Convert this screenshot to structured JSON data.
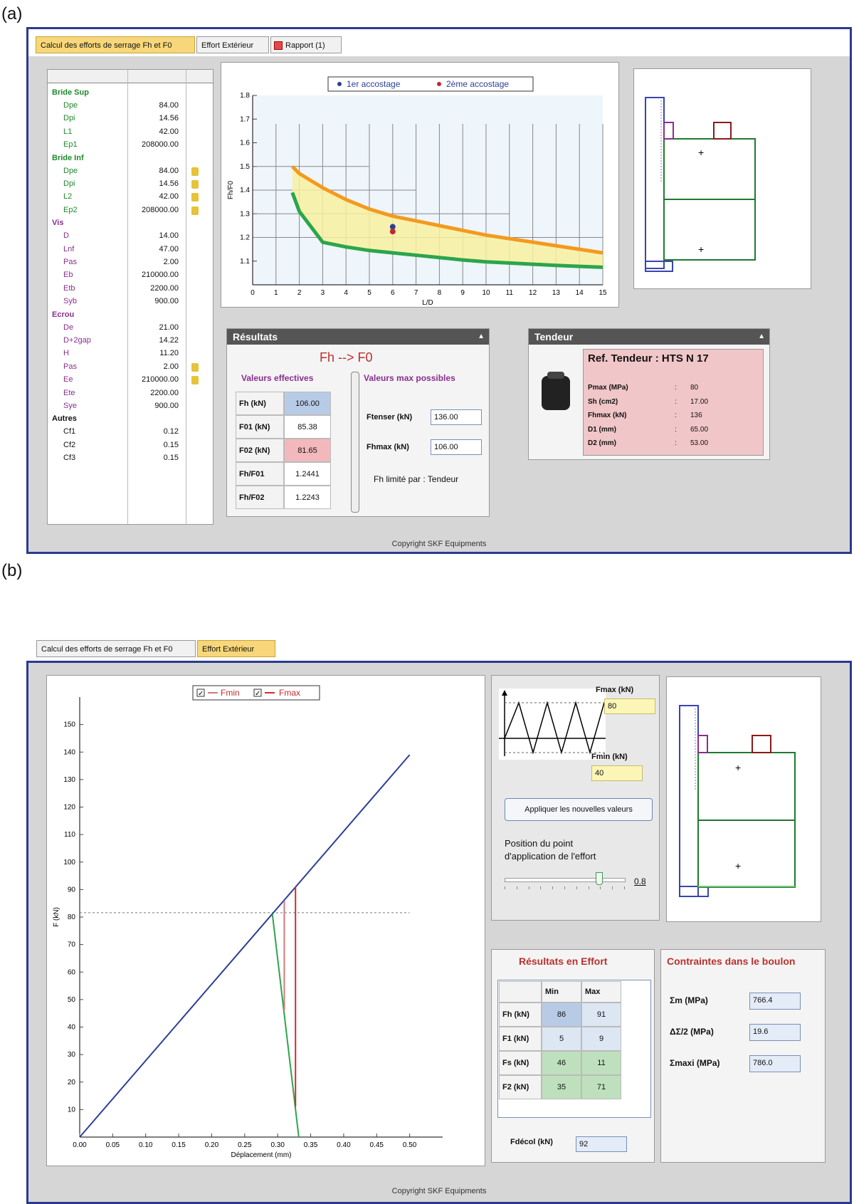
{
  "labels": {
    "a": "(a)",
    "b": "(b)"
  },
  "window_a": {
    "tabs": [
      {
        "label": "Calcul des efforts de serrage Fh et F0",
        "active": true
      },
      {
        "label": "Effort Extérieur",
        "active": false
      },
      {
        "label": "Rapport (1)",
        "active": false
      }
    ],
    "copyright": "Copyright SKF Equipments",
    "tree": [
      {
        "group": "Bride Sup",
        "color": "g",
        "items": [
          {
            "name": "Dpe",
            "value": "84.00"
          },
          {
            "name": "Dpi",
            "value": "14.56"
          },
          {
            "name": "L1",
            "value": "42.00"
          },
          {
            "name": "Ep1",
            "value": "208000.00"
          }
        ]
      },
      {
        "group": "Bride Inf",
        "color": "g",
        "items": [
          {
            "name": "Dpe",
            "value": "84.00",
            "lock": true
          },
          {
            "name": "Dpi",
            "value": "14.56",
            "lock": true
          },
          {
            "name": "L2",
            "value": "42.00",
            "lock": true
          },
          {
            "name": "Ep2",
            "value": "208000.00",
            "lock": true
          }
        ]
      },
      {
        "group": "Vis",
        "color": "m",
        "items": [
          {
            "name": "D",
            "value": "14.00"
          },
          {
            "name": "Lnf",
            "value": "47.00"
          },
          {
            "name": "Pas",
            "value": "2.00"
          },
          {
            "name": "Eb",
            "value": "210000.00"
          },
          {
            "name": "Etb",
            "value": "2200.00"
          },
          {
            "name": "Syb",
            "value": "900.00"
          }
        ]
      },
      {
        "group": "Ecrou",
        "color": "m",
        "items": [
          {
            "name": "De",
            "value": "21.00"
          },
          {
            "name": "D+2gap",
            "value": "14.22"
          },
          {
            "name": "H",
            "value": "11.20"
          },
          {
            "name": "Pas",
            "value": "2.00",
            "lock": true
          },
          {
            "name": "Ee",
            "value": "210000.00",
            "lock": true
          },
          {
            "name": "Ete",
            "value": "2200.00"
          },
          {
            "name": "Sye",
            "value": "900.00"
          }
        ]
      },
      {
        "group": "Autres",
        "color": "k",
        "items": [
          {
            "name": "Cf1",
            "value": "0.12"
          },
          {
            "name": "Cf2",
            "value": "0.15"
          },
          {
            "name": "Cf3",
            "value": "0.15"
          }
        ]
      }
    ],
    "chart_legend": [
      "1er accostage",
      "2ème accostage"
    ],
    "resultats": {
      "header": "Résultats",
      "title": "Fh --> F0",
      "eff_title": "Valeurs effectives",
      "max_title": "Valeurs max possibles",
      "rows": [
        {
          "label": "Fh (kN)",
          "value": "106.00",
          "bg": "#b8cbe6"
        },
        {
          "label": "F01 (kN)",
          "value": "85.38",
          "bg": "#ffffff"
        },
        {
          "label": "F02 (kN)",
          "value": "81.65",
          "bg": "#f3b8bb"
        },
        {
          "label": "Fh/F01",
          "value": "1.2441",
          "bg": "#ffffff"
        },
        {
          "label": "Fh/F02",
          "value": "1.2243",
          "bg": "#ffffff"
        }
      ],
      "ftenser_label": "Ftenser (kN)",
      "ftenser_value": "136.00",
      "fhmax_label": "Fhmax (kN)",
      "fhmax_value": "106.00",
      "limit_text": "Fh limité par : Tendeur"
    },
    "tendeur": {
      "header": "Tendeur",
      "ref": "Ref. Tendeur : HTS N 17",
      "rows": [
        {
          "label": "Pmax (MPa)",
          "value": "80"
        },
        {
          "label": "Sh (cm2)",
          "value": "17.00"
        },
        {
          "label": "Fhmax (kN)",
          "value": "136"
        },
        {
          "label": "D1 (mm)",
          "value": "65.00"
        },
        {
          "label": "D2 (mm)",
          "value": "53.00"
        }
      ]
    }
  },
  "window_b": {
    "tabs": [
      {
        "label": "Calcul des efforts de serrage Fh et F0",
        "active": false
      },
      {
        "label": "Effort Extérieur",
        "active": true
      }
    ],
    "copyright": "Copyright SKF Equipments",
    "chart_legend": [
      "Fmin",
      "Fmax"
    ],
    "fmax_label": "Fmax (kN)",
    "fmax_value": "80",
    "fmin_label": "Fmin (kN)",
    "fmin_value": "40",
    "apply_label": "Appliquer les nouvelles valeurs",
    "position_label_1": "Position du point",
    "position_label_2": "d'application de l'effort",
    "position_value": "0.8",
    "position_fraction": 0.8,
    "res_effort": {
      "title": "Résultats en Effort",
      "headers": [
        "Min",
        "Max"
      ],
      "rows": [
        {
          "label": "Fh (kN)",
          "min": "86",
          "max": "91",
          "bg": [
            "#b8cbe6",
            "#dde6f3"
          ]
        },
        {
          "label": "F1 (kN)",
          "min": "5",
          "max": "9",
          "bg": [
            "#dde6f3",
            "#dde6f3"
          ]
        },
        {
          "label": "Fs (kN)",
          "min": "46",
          "max": "11",
          "bg": [
            "#bfe0bd",
            "#bfe0bd"
          ]
        },
        {
          "label": "F2 (kN)",
          "min": "35",
          "max": "71",
          "bg": [
            "#bfe0bd",
            "#bfe0bd"
          ]
        }
      ],
      "fdecol_label": "Fdécol (kN)",
      "fdecol_value": "92"
    },
    "contraintes": {
      "title": "Contraintes dans le boulon",
      "rows": [
        {
          "label": "Σm (MPa)",
          "value": "766.4"
        },
        {
          "label": "ΔΣ/2 (MPa)",
          "value": "19.6"
        },
        {
          "label": "Σmaxi (MPa)",
          "value": "786.0"
        }
      ]
    }
  },
  "chart_data": [
    {
      "type": "line",
      "xlabel": "L/D",
      "ylabel": "Fh/F0",
      "xlim": [
        0,
        15
      ],
      "ylim": [
        1.0,
        1.8
      ],
      "xticks": [
        0,
        1,
        2,
        3,
        4,
        5,
        6,
        7,
        8,
        9,
        10,
        11,
        12,
        13,
        14,
        15
      ],
      "yticks": [
        1.1,
        1.2,
        1.3,
        1.4,
        1.5,
        1.6,
        1.7,
        1.8
      ],
      "series": [
        {
          "name": "",
          "color": "#f39a1e",
          "x": [
            1.7,
            2,
            3,
            4,
            5,
            6,
            7,
            8,
            9,
            10,
            11,
            12,
            13,
            14,
            15
          ],
          "y": [
            1.5,
            1.47,
            1.41,
            1.36,
            1.32,
            1.29,
            1.27,
            1.25,
            1.23,
            1.21,
            1.195,
            1.18,
            1.165,
            1.15,
            1.135
          ]
        },
        {
          "name": "",
          "color": "#2ca54a",
          "x": [
            1.7,
            2,
            3,
            4,
            5,
            6,
            7,
            8,
            9,
            10,
            11,
            12,
            13,
            14,
            15
          ],
          "y": [
            1.39,
            1.31,
            1.18,
            1.16,
            1.145,
            1.135,
            1.125,
            1.115,
            1.105,
            1.097,
            1.092,
            1.087,
            1.082,
            1.078,
            1.074
          ]
        }
      ],
      "points": [
        {
          "series": "1er accostage",
          "x": 6,
          "y": 1.245,
          "color": "#2c3e9a"
        },
        {
          "series": "2ème accostage",
          "x": 6,
          "y": 1.225,
          "color": "#c02a2a"
        }
      ],
      "grid": true
    },
    {
      "type": "line",
      "xlabel": "Déplacement (mm)",
      "ylabel": "F (kN)",
      "xlim": [
        0,
        0.55
      ],
      "ylim": [
        0,
        160
      ],
      "xticks": [
        0.0,
        0.05,
        0.1,
        0.15,
        0.2,
        0.25,
        0.3,
        0.35,
        0.4,
        0.45,
        0.5
      ],
      "yticks": [
        10,
        20,
        30,
        40,
        50,
        60,
        70,
        80,
        90,
        100,
        110,
        120,
        130,
        140,
        150
      ],
      "series": [
        {
          "name": "",
          "color": "#2c3e9a",
          "x": [
            0,
            0.5
          ],
          "y": [
            0,
            139
          ]
        },
        {
          "name": "",
          "color": "#2ca54a",
          "x": [
            0.292,
            0.332
          ],
          "y": [
            81,
            0
          ]
        },
        {
          "name": "Fmin",
          "color": "#d07a7a",
          "x": [
            0.31,
            0.31
          ],
          "y": [
            86,
            46
          ]
        },
        {
          "name": "Fmax",
          "color": "#d42a2a",
          "x": [
            0.327,
            0.327
          ],
          "y": [
            91,
            11
          ]
        }
      ],
      "hline": 81.6,
      "grid": false
    }
  ]
}
